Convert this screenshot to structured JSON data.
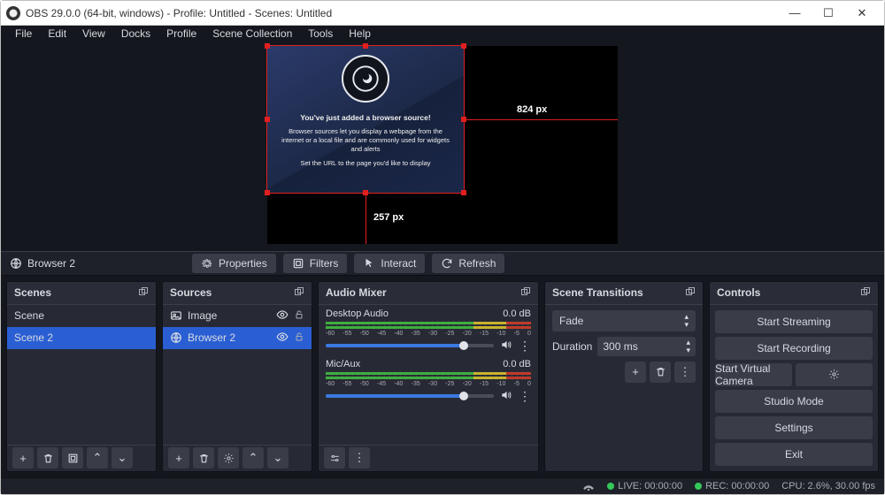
{
  "titlebar": {
    "title": "OBS 29.0.0 (64-bit, windows) - Profile: Untitled - Scenes: Untitled"
  },
  "menu": {
    "file": "File",
    "edit": "Edit",
    "view": "View",
    "docks": "Docks",
    "profile": "Profile",
    "scene_collection": "Scene Collection",
    "tools": "Tools",
    "help": "Help"
  },
  "preview": {
    "width_label": "824 px",
    "height_label": "257 px",
    "browser_source": {
      "line1": "You've just added a browser source!",
      "line2": "Browser sources let you display a webpage from the internet or a local file and are commonly used for widgets and alerts",
      "line3": "Set the URL to the page you'd like to display"
    }
  },
  "source_toolbar": {
    "selected": "Browser 2",
    "properties": "Properties",
    "filters": "Filters",
    "interact": "Interact",
    "refresh": "Refresh"
  },
  "panels": {
    "scenes": {
      "title": "Scenes",
      "items": [
        "Scene",
        "Scene 2"
      ],
      "selected_index": 1
    },
    "sources": {
      "title": "Sources",
      "items": [
        {
          "icon": "image-icon",
          "label": "Image"
        },
        {
          "icon": "globe-icon",
          "label": "Browser 2"
        }
      ],
      "selected_index": 1
    },
    "audio": {
      "title": "Audio Mixer",
      "ticks": [
        "-60",
        "-55",
        "-50",
        "-45",
        "-40",
        "-35",
        "-30",
        "-25",
        "-20",
        "-15",
        "-10",
        "-5",
        "0"
      ],
      "channels": [
        {
          "name": "Desktop Audio",
          "db": "0.0 dB"
        },
        {
          "name": "Mic/Aux",
          "db": "0.0 dB"
        }
      ]
    },
    "transitions": {
      "title": "Scene Transitions",
      "current": "Fade",
      "duration_label": "Duration",
      "duration_value": "300 ms"
    },
    "controls": {
      "title": "Controls",
      "start_stream": "Start Streaming",
      "start_record": "Start Recording",
      "virtual_cam": "Start Virtual Camera",
      "studio_mode": "Studio Mode",
      "settings": "Settings",
      "exit": "Exit"
    }
  },
  "status": {
    "live": "LIVE: 00:00:00",
    "rec": "REC: 00:00:00",
    "cpu": "CPU: 2.6%, 30.00 fps"
  }
}
